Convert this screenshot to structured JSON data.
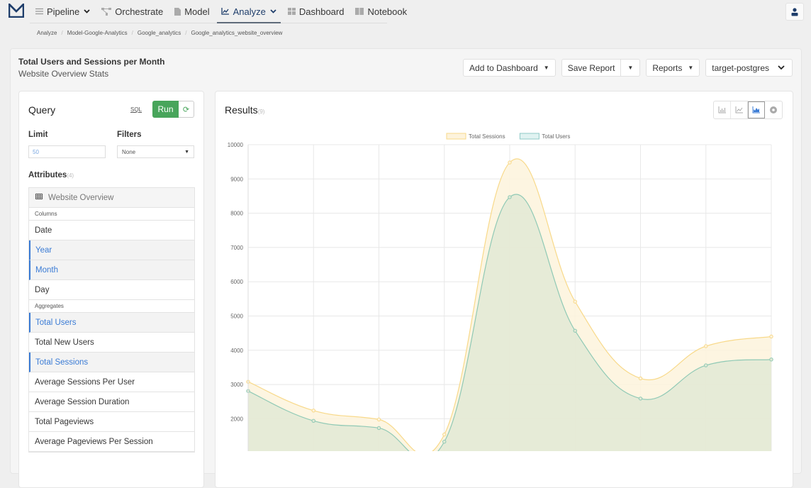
{
  "nav": {
    "items": [
      {
        "label": "Pipeline",
        "icon": "list-icon",
        "dropdown": true
      },
      {
        "label": "Orchestrate",
        "icon": "workflow-icon",
        "dropdown": false
      },
      {
        "label": "Model",
        "icon": "document-icon",
        "dropdown": false
      },
      {
        "label": "Analyze",
        "icon": "chart-icon",
        "dropdown": true,
        "active": true
      },
      {
        "label": "Dashboard",
        "icon": "grid-icon",
        "dropdown": false
      },
      {
        "label": "Notebook",
        "icon": "book-icon",
        "dropdown": false
      }
    ]
  },
  "breadcrumb": [
    "Analyze",
    "Model-Google-Analytics",
    "Google_analytics",
    "Google_analytics_website_overview"
  ],
  "header": {
    "title": "Total Users and Sessions per Month",
    "subtitle": "Website Overview Stats",
    "add_to_dashboard": "Add to Dashboard",
    "save_report": "Save Report",
    "reports": "Reports",
    "connection": "target-postgres"
  },
  "query": {
    "title": "Query",
    "sql_link": "SQL",
    "run_label": "Run",
    "limit_label": "Limit",
    "limit_value": "50",
    "filters_label": "Filters",
    "filters_value": "None",
    "attributes_label": "Attributes",
    "attributes_count": "(4)",
    "table_name": "Website Overview",
    "columns_label": "Columns",
    "columns": [
      {
        "label": "Date",
        "selected": false
      },
      {
        "label": "Year",
        "selected": true
      },
      {
        "label": "Month",
        "selected": true
      },
      {
        "label": "Day",
        "selected": false
      }
    ],
    "aggregates_label": "Aggregates",
    "aggregates": [
      {
        "label": "Total Users",
        "selected": true
      },
      {
        "label": "Total New Users",
        "selected": false
      },
      {
        "label": "Total Sessions",
        "selected": true
      },
      {
        "label": "Average Sessions Per User",
        "selected": false
      },
      {
        "label": "Average Session Duration",
        "selected": false
      },
      {
        "label": "Total Pageviews",
        "selected": false
      },
      {
        "label": "Average Pageviews Per Session",
        "selected": false
      }
    ]
  },
  "results": {
    "title": "Results",
    "count": "(9)",
    "chart_types": [
      "bar-chart-icon",
      "line-chart-icon",
      "area-chart-icon",
      "pie-chart-icon"
    ],
    "active_chart_type": "area-chart-icon"
  },
  "chart_data": {
    "type": "area",
    "title": "",
    "xlabel": "",
    "ylabel": "",
    "ylim": [
      1000,
      10000
    ],
    "yticks": [
      10000,
      9000,
      8000,
      7000,
      6000,
      5000,
      4000,
      3000,
      2000
    ],
    "grid": true,
    "legend": "top",
    "x": [
      1,
      2,
      3,
      4,
      5,
      6,
      7,
      8,
      9
    ],
    "series": [
      {
        "name": "Total Sessions",
        "color": "#f8d98a",
        "fill": "#fdf3dc",
        "values": [
          3080,
          2240,
          1980,
          1540,
          9480,
          5420,
          3180,
          4120,
          4400
        ]
      },
      {
        "name": "Total Users",
        "color": "#8fc9b5",
        "fill": "#e2e9d5",
        "values": [
          2810,
          1940,
          1730,
          1330,
          8470,
          4570,
          2590,
          3560,
          3730
        ]
      }
    ]
  }
}
